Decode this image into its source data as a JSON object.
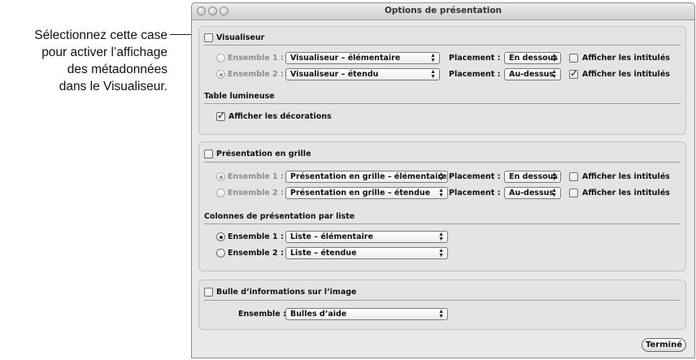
{
  "callout": {
    "lines": [
      "Sélectionnez cette case",
      "pour activer l’affichage",
      "des métadonnées",
      "dans le Visualiseur."
    ]
  },
  "window": {
    "title": "Options de présentation",
    "done_label": "Terminé"
  },
  "visualiseur": {
    "label": "Visualiseur",
    "checked": false,
    "sets": [
      {
        "label": "Ensemble 1 :",
        "value": "Visualiseur – élémentaire",
        "placement_label": "Placement :",
        "placement": "En dessous",
        "show_labels": "Afficher les intitulés",
        "show_labels_checked": false,
        "selected": false
      },
      {
        "label": "Ensemble 2 :",
        "value": "Visualiseur – étendu",
        "placement_label": "Placement :",
        "placement": "Au-dessus",
        "show_labels": "Afficher les intitulés",
        "show_labels_checked": true,
        "selected": true
      }
    ]
  },
  "table_lumineuse": {
    "label": "Table lumineuse",
    "decorations_label": "Afficher les décorations",
    "decorations_checked": true
  },
  "grille": {
    "label": "Présentation en grille",
    "checked": false,
    "sets": [
      {
        "label": "Ensemble 1 :",
        "value": "Présentation en grille – élémentaire",
        "placement_label": "Placement :",
        "placement": "En dessous",
        "show_labels": "Afficher les intitulés",
        "show_labels_checked": false,
        "selected": true
      },
      {
        "label": "Ensemble 2 :",
        "value": "Présentation en grille – étendue",
        "placement_label": "Placement :",
        "placement": "Au-dessus",
        "show_labels": "Afficher les intitulés",
        "show_labels_checked": false,
        "selected": false
      }
    ]
  },
  "liste": {
    "label": "Colonnes de présentation par liste",
    "sets": [
      {
        "label": "Ensemble 1 :",
        "value": "Liste – élémentaire",
        "selected": true
      },
      {
        "label": "Ensemble 2 :",
        "value": "Liste – étendue",
        "selected": false
      }
    ]
  },
  "bulle": {
    "label": "Bulle d’informations sur l’image",
    "checked": false,
    "set_label": "Ensemble :",
    "set_value": "Bulles d’aide"
  }
}
